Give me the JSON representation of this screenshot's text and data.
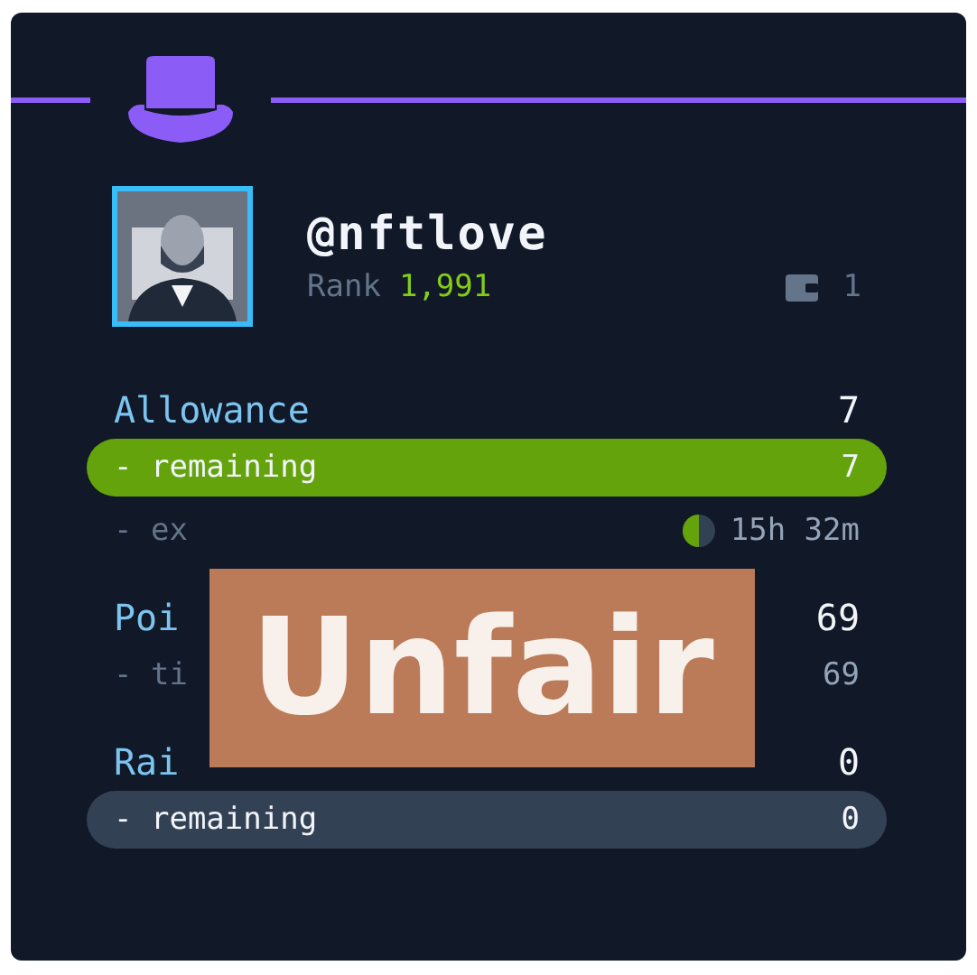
{
  "profile": {
    "username": "@nftlove",
    "rank_label": "Rank",
    "rank": "1,991",
    "wallet_count": "1"
  },
  "stats": [
    {
      "kind": "heading",
      "label": "Allowance",
      "value": "7"
    },
    {
      "kind": "bar",
      "label": "- remaining",
      "value": "7",
      "color": "#65a30d"
    },
    {
      "kind": "sub",
      "label": "- ex",
      "value": "15h 32m",
      "timer": true
    },
    {
      "kind": "heading",
      "label": "Poi",
      "value": "69"
    },
    {
      "kind": "sub",
      "label": "- ti",
      "value": "69"
    },
    {
      "kind": "heading",
      "label": "Rai",
      "value": "0"
    },
    {
      "kind": "bar",
      "label": "- remaining",
      "value": "0",
      "color": "#334155"
    }
  ],
  "sticker": {
    "text": "Unfair"
  }
}
